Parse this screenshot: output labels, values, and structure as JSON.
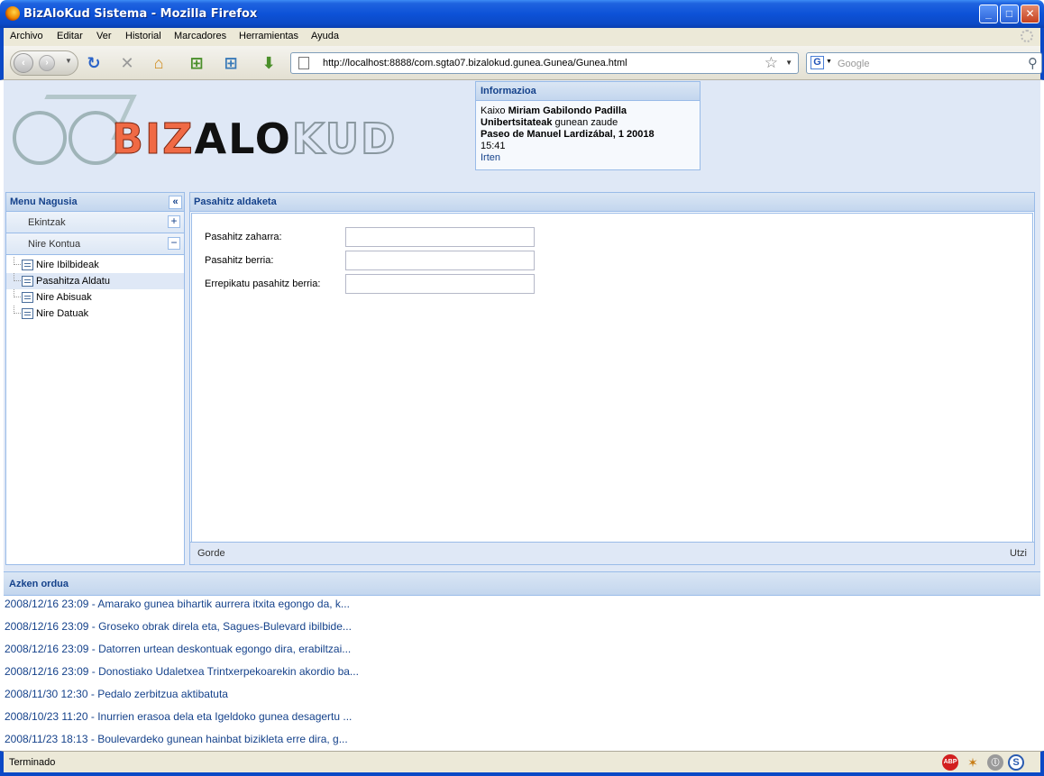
{
  "window": {
    "title": "BizAloKud Sistema - Mozilla Firefox"
  },
  "menu": [
    "Archivo",
    "Editar",
    "Ver",
    "Historial",
    "Marcadores",
    "Herramientas",
    "Ayuda"
  ],
  "nav": {
    "url": "http://localhost:8888/com.sgta07.bizalokud.gunea.Gunea/Gunea.html",
    "search_placeholder": "Google",
    "search_engine_letter": "G"
  },
  "logo": {
    "part1": "BIZ",
    "part2": "ALO",
    "part3": "KUD"
  },
  "info": {
    "title": "Informazioa",
    "greeting": "Kaixo",
    "user": "Miriam Gabilondo Padilla",
    "place": "Unibertsitateak",
    "place_suffix": "gunean zaude",
    "address": "Paseo de Manuel Lardizábal, 1 20018",
    "time": "15:41",
    "logout": "Irten"
  },
  "west": {
    "title": "Menu Nagusia",
    "collapse_glyph": "«",
    "sections": [
      {
        "label": "Ekintzak",
        "toggle": "+"
      },
      {
        "label": "Nire Kontua",
        "toggle": "−"
      }
    ],
    "items": [
      "Nire Ibilbideak",
      "Pasahitza Aldatu",
      "Nire Abisuak",
      "Nire Datuak"
    ]
  },
  "form": {
    "title": "Pasahitz aldaketa",
    "fields": [
      {
        "label": "Pasahitz zaharra:",
        "value": ""
      },
      {
        "label": "Pasahitz berria:",
        "value": ""
      },
      {
        "label": "Errepikatu pasahitz berria:",
        "value": ""
      }
    ],
    "save": "Gorde",
    "cancel": "Utzi"
  },
  "news": {
    "title": "Azken ordua",
    "items": [
      "2008/12/16 23:09 - Amarako gunea bihartik aurrera itxita egongo da, k...",
      "2008/12/16 23:09 - Groseko obrak direla eta, Sagues-Bulevard ibilbide...",
      "2008/12/16 23:09 - Datorren urtean deskontuak egongo dira, erabiltzai...",
      "2008/12/16 23:09 - Donostiako Udaletxea Trintxerpekoarekin akordio ba...",
      "2008/11/30 12:30 - Pedalo zerbitzua aktibatuta",
      "2008/10/23 11:20 - Inurrien erasoa dela eta Igeldoko gunea desagertu ...",
      "2008/11/23 18:13 - Boulevardeko gunean hainbat bizikleta erre dira, g..."
    ]
  },
  "status": {
    "text": "Terminado",
    "abp_label": "ABP",
    "s_label": "S"
  }
}
